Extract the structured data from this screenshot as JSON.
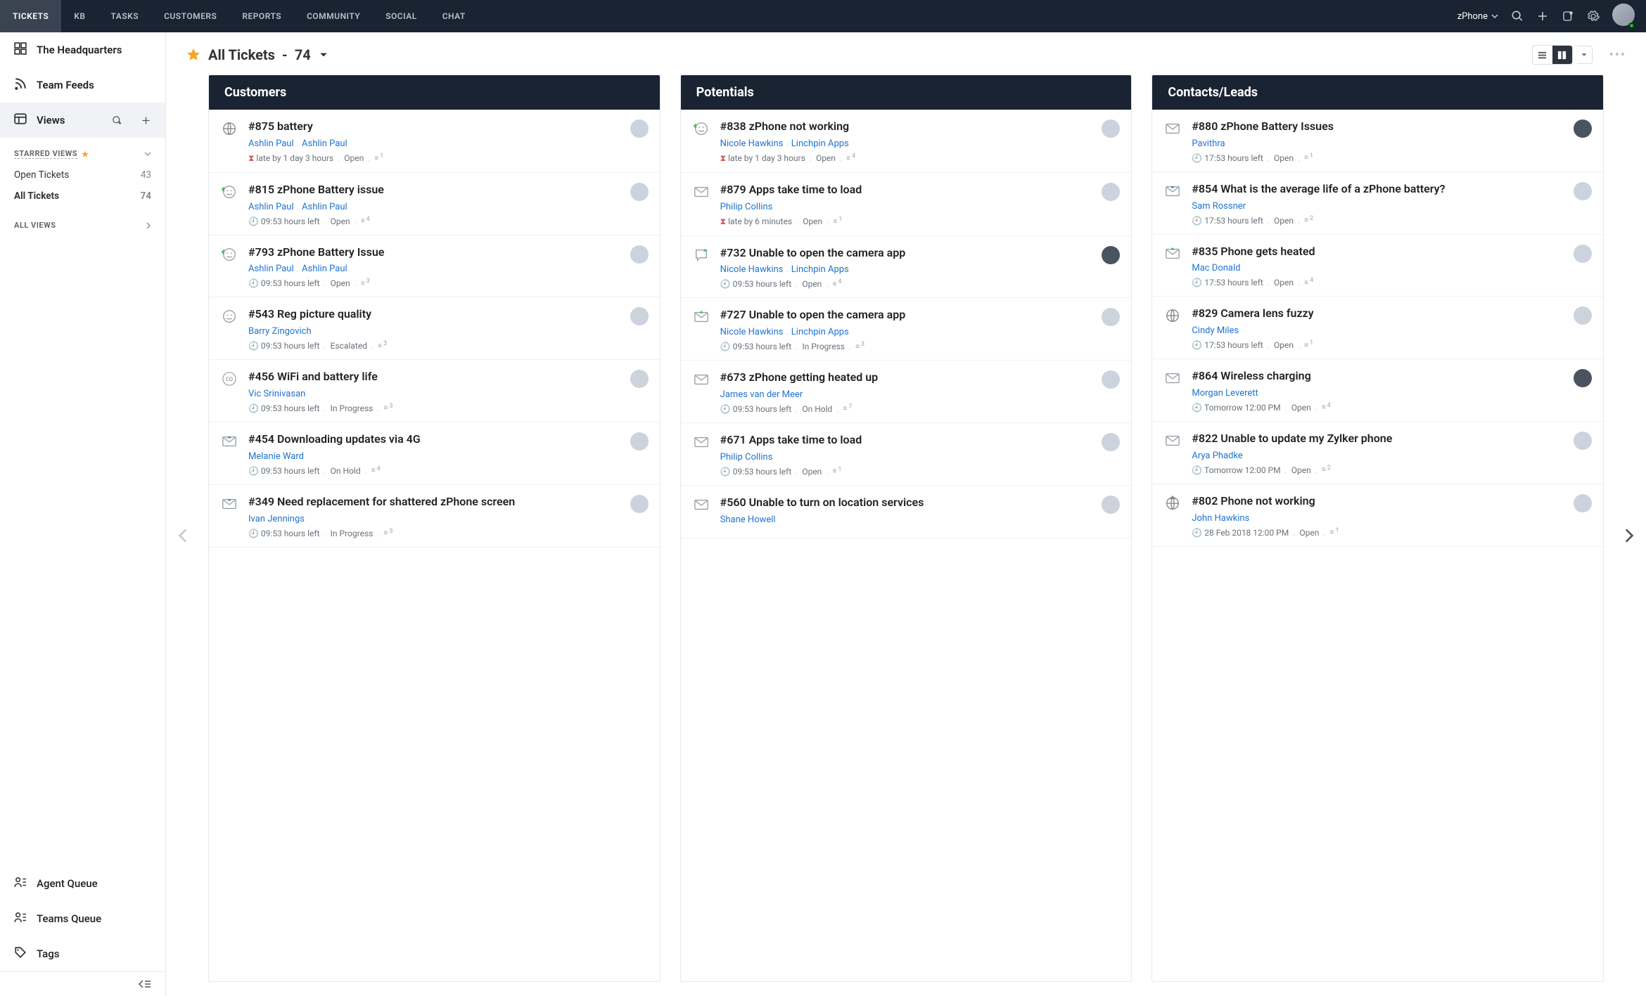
{
  "topnav": {
    "tabs": [
      "TICKETS",
      "KB",
      "TASKS",
      "CUSTOMERS",
      "REPORTS",
      "COMMUNITY",
      "SOCIAL",
      "CHAT"
    ],
    "active_tab": 0,
    "brand": "zPhone"
  },
  "sidebar": {
    "items": [
      {
        "icon": "grid",
        "label": "The Headquarters"
      },
      {
        "icon": "feed",
        "label": "Team Feeds"
      },
      {
        "icon": "views",
        "label": "Views",
        "active": true,
        "actions": true
      }
    ],
    "starred_head": "STARRED VIEWS",
    "starred": [
      {
        "label": "Open Tickets",
        "count": "43"
      },
      {
        "label": "All Tickets",
        "count": "74",
        "strong": true
      }
    ],
    "all_views_head": "ALL VIEWS",
    "footer": [
      {
        "icon": "queue",
        "label": "Agent Queue"
      },
      {
        "icon": "queue",
        "label": "Teams Queue"
      },
      {
        "icon": "tag",
        "label": "Tags"
      }
    ]
  },
  "page": {
    "title_prefix": "All Tickets",
    "sep": " - ",
    "count": "74"
  },
  "columns": [
    {
      "title": "Customers",
      "cards": [
        {
          "channel": "globe",
          "title": "#875 battery",
          "who": [
            "Ashlin Paul",
            "Ashlin Paul"
          ],
          "meta_pre": "⧗ late by 1 day 3 hours",
          "status": "Open",
          "threads": "1",
          "clock": "red",
          "avatar": "light"
        },
        {
          "channel": "happy-green",
          "title": "#815 zPhone Battery issue",
          "who": [
            "Ashlin Paul",
            "Ashlin Paul"
          ],
          "meta_pre": "🕘 09:53 hours left",
          "status": "Open",
          "threads": "4",
          "clock": "orange",
          "avatar": "light"
        },
        {
          "channel": "happy-green",
          "title": "#793 zPhone Battery Issue",
          "who": [
            "Ashlin Paul",
            "Ashlin Paul"
          ],
          "meta_pre": "🕘 09:53 hours left",
          "status": "Open",
          "threads": "3",
          "clock": "orange",
          "avatar": "light"
        },
        {
          "channel": "happy-grey",
          "title": "#543 Reg picture quality",
          "who": [
            "Barry Zingovich"
          ],
          "meta_pre": "🕘 09:53 hours left",
          "status": "Escalated",
          "threads": "3",
          "clock": "orange",
          "avatar": "light"
        },
        {
          "channel": "co",
          "title": "#456 WiFi and battery life",
          "who": [
            "Vic Srinivasan"
          ],
          "meta_pre": "🕘 09:53 hours left",
          "status": "In Progress",
          "threads": "3",
          "clock": "green",
          "avatar": "light"
        },
        {
          "channel": "mail-blue",
          "title": "#454 Downloading updates via 4G",
          "who": [
            "Melanie Ward"
          ],
          "meta_pre": "🕘 09:53 hours left",
          "status": "On Hold",
          "threads": "4",
          "clock": "orange",
          "avatar": "light"
        },
        {
          "channel": "mail-blue",
          "title": "#349 Need replacement for shattered zPhone screen",
          "who": [
            "Ivan Jennings"
          ],
          "meta_pre": "🕘 09:53 hours left",
          "status": "In Progress",
          "threads": "3",
          "clock": "orange",
          "avatar": "light"
        }
      ]
    },
    {
      "title": "Potentials",
      "cards": [
        {
          "channel": "happy-green",
          "title": "#838 zPhone not working",
          "who": [
            "Nicole Hawkins",
            "Linchpin Apps"
          ],
          "meta_pre": "⧗ late by 1 day 3 hours",
          "status": "Open",
          "threads": "4",
          "clock": "red",
          "avatar": "light"
        },
        {
          "channel": "mail",
          "title": "#879 Apps take time to load",
          "who": [
            "Philip Collins"
          ],
          "meta_pre": "⧗ late by 6 minutes",
          "status": "Open",
          "threads": "1",
          "clock": "red",
          "avatar": "light"
        },
        {
          "channel": "chat-green",
          "title": "#732 Unable to open the camera app",
          "who": [
            "Nicole Hawkins",
            "Linchpin Apps"
          ],
          "meta_pre": "🕘 09:53 hours left",
          "status": "Open",
          "threads": "4",
          "clock": "orange",
          "avatar": "dark"
        },
        {
          "channel": "mail-green",
          "title": "#727 Unable to open the camera app",
          "who": [
            "Nicole Hawkins",
            "Linchpin Apps"
          ],
          "meta_pre": "🕘 09:53 hours left",
          "status": "In Progress",
          "threads": "3",
          "clock": "orange",
          "avatar": "light"
        },
        {
          "channel": "mail",
          "title": "#673 zPhone getting heated up",
          "who": [
            "James van der Meer"
          ],
          "meta_pre": "🕘 09:53 hours left",
          "status": "On Hold",
          "threads": "7",
          "clock": "orange",
          "avatar": "light"
        },
        {
          "channel": "mail",
          "title": "#671 Apps take time to load",
          "who": [
            "Philip Collins"
          ],
          "meta_pre": "🕘 09:53 hours left",
          "status": "Open",
          "threads": "1",
          "clock": "orange",
          "avatar": "light"
        },
        {
          "channel": "mail",
          "title": "#560 Unable to turn on location services",
          "who": [
            "Shane Howell"
          ],
          "meta_pre": "",
          "status": "",
          "threads": "",
          "clock": "",
          "avatar": "light"
        }
      ]
    },
    {
      "title": "Contacts/Leads",
      "cards": [
        {
          "channel": "mail",
          "title": "#880 zPhone Battery Issues",
          "who": [
            "Pavithra"
          ],
          "meta_pre": "🕘 17:53 hours left",
          "status": "Open",
          "threads": "1",
          "clock": "grey",
          "avatar": "dark"
        },
        {
          "channel": "mail-blue",
          "title": "#854 What is the average life of a zPhone battery?",
          "who": [
            "Sam Rossner"
          ],
          "meta_pre": "🕘 17:53 hours left",
          "status": "Open",
          "threads": "2",
          "clock": "grey",
          "avatar": "light"
        },
        {
          "channel": "mail-green",
          "title": "#835 Phone gets heated",
          "who": [
            "Mac Donald"
          ],
          "meta_pre": "🕘 17:53 hours left",
          "status": "Open",
          "threads": "4",
          "clock": "red",
          "avatar": "light"
        },
        {
          "channel": "globe",
          "title": "#829 Camera lens fuzzy",
          "who": [
            "Cindy Miles"
          ],
          "meta_pre": "🕘 17:53 hours left",
          "status": "Open",
          "threads": "1",
          "clock": "orange",
          "avatar": "light"
        },
        {
          "channel": "mail",
          "title": "#864 Wireless charging",
          "who": [
            "Morgan Leverett"
          ],
          "meta_pre": "🕘 Tomorrow 12:00 PM",
          "status": "Open",
          "threads": "4",
          "clock": "grey",
          "avatar": "dark"
        },
        {
          "channel": "mail",
          "title": "#822 Unable to update my Zylker phone",
          "who": [
            "Arya Phadke"
          ],
          "meta_pre": "🕘 Tomorrow 12:00 PM",
          "status": "Open",
          "threads": "2",
          "clock": "red",
          "avatar": "light"
        },
        {
          "channel": "globe-green",
          "title": "#802 Phone not working",
          "who": [
            "John Hawkins"
          ],
          "meta_pre": "🕘 28 Feb 2018 12:00 PM",
          "status": "Open",
          "threads": "1",
          "clock": "orange",
          "avatar": "light"
        }
      ]
    }
  ]
}
